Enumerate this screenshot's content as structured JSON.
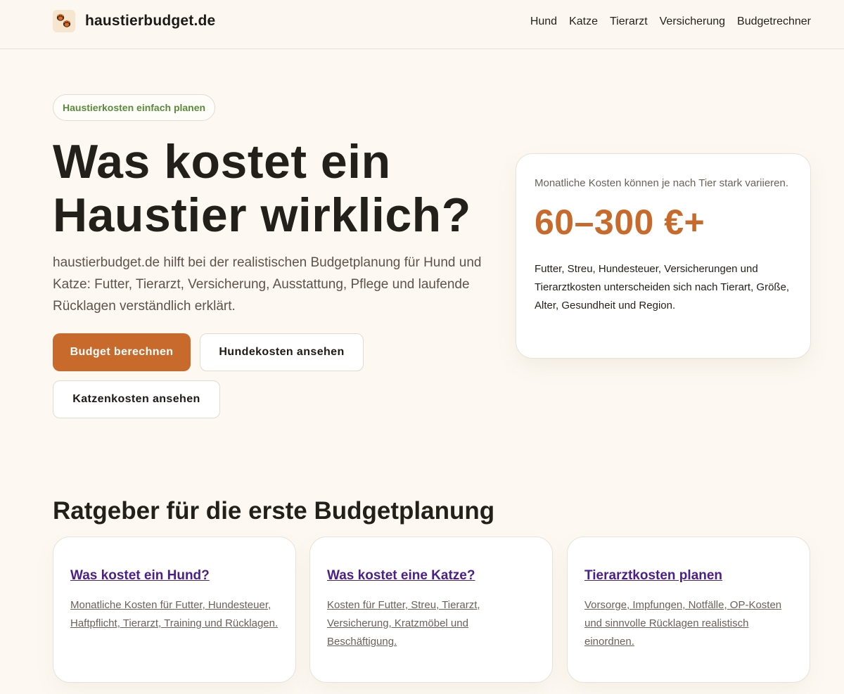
{
  "header": {
    "logo_text": "haustierbudget.de",
    "nav": [
      "Hund",
      "Katze",
      "Tierarzt",
      "Versicherung",
      "Budgetrechner"
    ]
  },
  "hero": {
    "pill": "Haustierkosten einfach planen",
    "title": "Was kostet ein Haustier wirklich?",
    "text": "haustierbudget.de hilft bei der realistischen Budgetplanung für Hund und Katze: Futter, Tierarzt, Versicherung, Ausstattung, Pflege und laufende Rücklagen verständlich erklärt.",
    "buttons": {
      "primary": "Budget berechnen",
      "dog": "Hundekosten ansehen",
      "cat": "Katzenkosten ansehen"
    }
  },
  "cost_card": {
    "note": "Monatliche Kosten können je nach Tier stark variieren.",
    "value": "60–300 €+",
    "desc": "Futter, Streu, Hundesteuer, Versicherungen und Tierarztkosten unterscheiden sich nach Tierart, Größe, Alter, Gesundheit und Region."
  },
  "guides": {
    "title": "Ratgeber für die erste Budgetplanung",
    "cards": [
      {
        "title": "Was kostet ein Hund?",
        "text": "Monatliche Kosten für Futter, Hundesteuer, Haftpflicht, Tierarzt, Training und Rücklagen."
      },
      {
        "title": "Was kostet eine Katze?",
        "text": "Kosten für Futter, Streu, Tierarzt, Versicherung, Kratzmöbel und Beschäftigung."
      },
      {
        "title": "Tierarztkosten planen",
        "text": "Vorsorge, Impfungen, Notfälle, OP-Kosten und sinnvolle Rücklagen realistisch einordnen."
      }
    ]
  },
  "colors": {
    "accent": "#c96a2d",
    "background": "#fdf9f2",
    "pill_text": "#5a8a3a",
    "link": "#4b1f87"
  },
  "icons": {
    "logo": "paw-icon"
  }
}
